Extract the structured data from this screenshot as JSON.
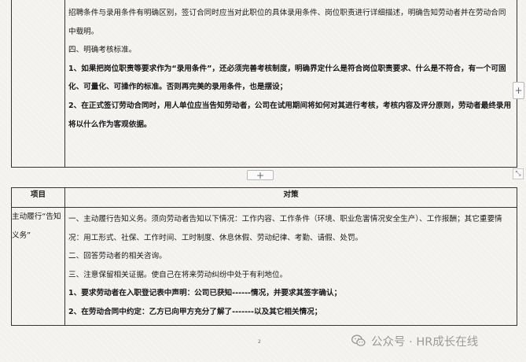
{
  "top_table": {
    "paragraphs": [
      {
        "text": "招聘条件与录用条件有明确区别，签订合同时应当对此职位的具体录用条件、岗位职责进行详细描述，明确告知劳动者并在劳动合同中载明。",
        "bold": false
      },
      {
        "text": "四、明确考核标准。",
        "bold": false
      },
      {
        "text": "1、如果把岗位职责等要求作为“录用条件”，还必须完善考核制度，明确界定什么是符合岗位职责要求、什么是不符合，有一个可固化、可量化、可操作的标准。否则再完美的录用条件，也是摆设；",
        "bold": true
      },
      {
        "text": "2、在正式签订劳动合同时，用人单位应当告知劳动者，公司在试用期间将如何对其进行考核，考核内容及评分原则，劳动者最终录用将以什么作为客观依据。",
        "bold": true
      }
    ]
  },
  "bottom_table": {
    "header": {
      "col1": "项目",
      "col2": "对策"
    },
    "item": "主动履行“告知义务”",
    "paragraphs": [
      {
        "text": "一、主动履行告知义务。须向劳动者告知以下情况：工作内容、工作条件（环境、职业危害情况安全生产）、工作报酬；其它重要情况：用工形式、社保、工作时间、工时制度、休息休假、劳动纪律、考勤、请假、处罚。",
        "bold": false
      },
      {
        "text": "二、回答劳动者的相关咨询。",
        "bold": false
      },
      {
        "text": "三、注意保留相关证据。使自己在将来劳动纠纷中处于有利地位。",
        "bold": false
      },
      {
        "text": "1、要求劳动者在入职登记表中声明：公司已获知------情况，并要求其签字确认；",
        "bold": true
      },
      {
        "text": "2、在劳动合同中约定：乙方已向甲方充分了解了-------以及其它相关情况；",
        "bold": true
      }
    ]
  },
  "controls": {
    "row_add": "+",
    "col_add": "+",
    "resize": "⤡"
  },
  "footer": {
    "page_number": "2",
    "watermark": "公众号 · HR成长在线"
  },
  "icons": {
    "watermark_logo": "wechat-icon"
  },
  "colors": {
    "border": "#333333",
    "page_bg": "#f6f4f1",
    "watermark": "#9a9a9a"
  }
}
